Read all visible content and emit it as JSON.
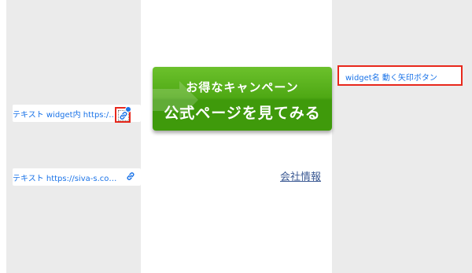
{
  "left_panel": {
    "rows": [
      {
        "text": "テキスト widget内 https://sq…",
        "icon": "link-icon"
      },
      {
        "text": "テキスト https://siva-s.com/",
        "icon": "link-icon"
      }
    ]
  },
  "cta": {
    "top_text": "お得なキャンペーン",
    "main_text": "公式ページを見てみる"
  },
  "company_link": "会社情報",
  "right_panel": {
    "widget_label": "widget名 動く矢印ボタン"
  },
  "colors": {
    "highlight": "#e8281c",
    "link": "#1a73e8",
    "button_green": "#4ea814"
  }
}
